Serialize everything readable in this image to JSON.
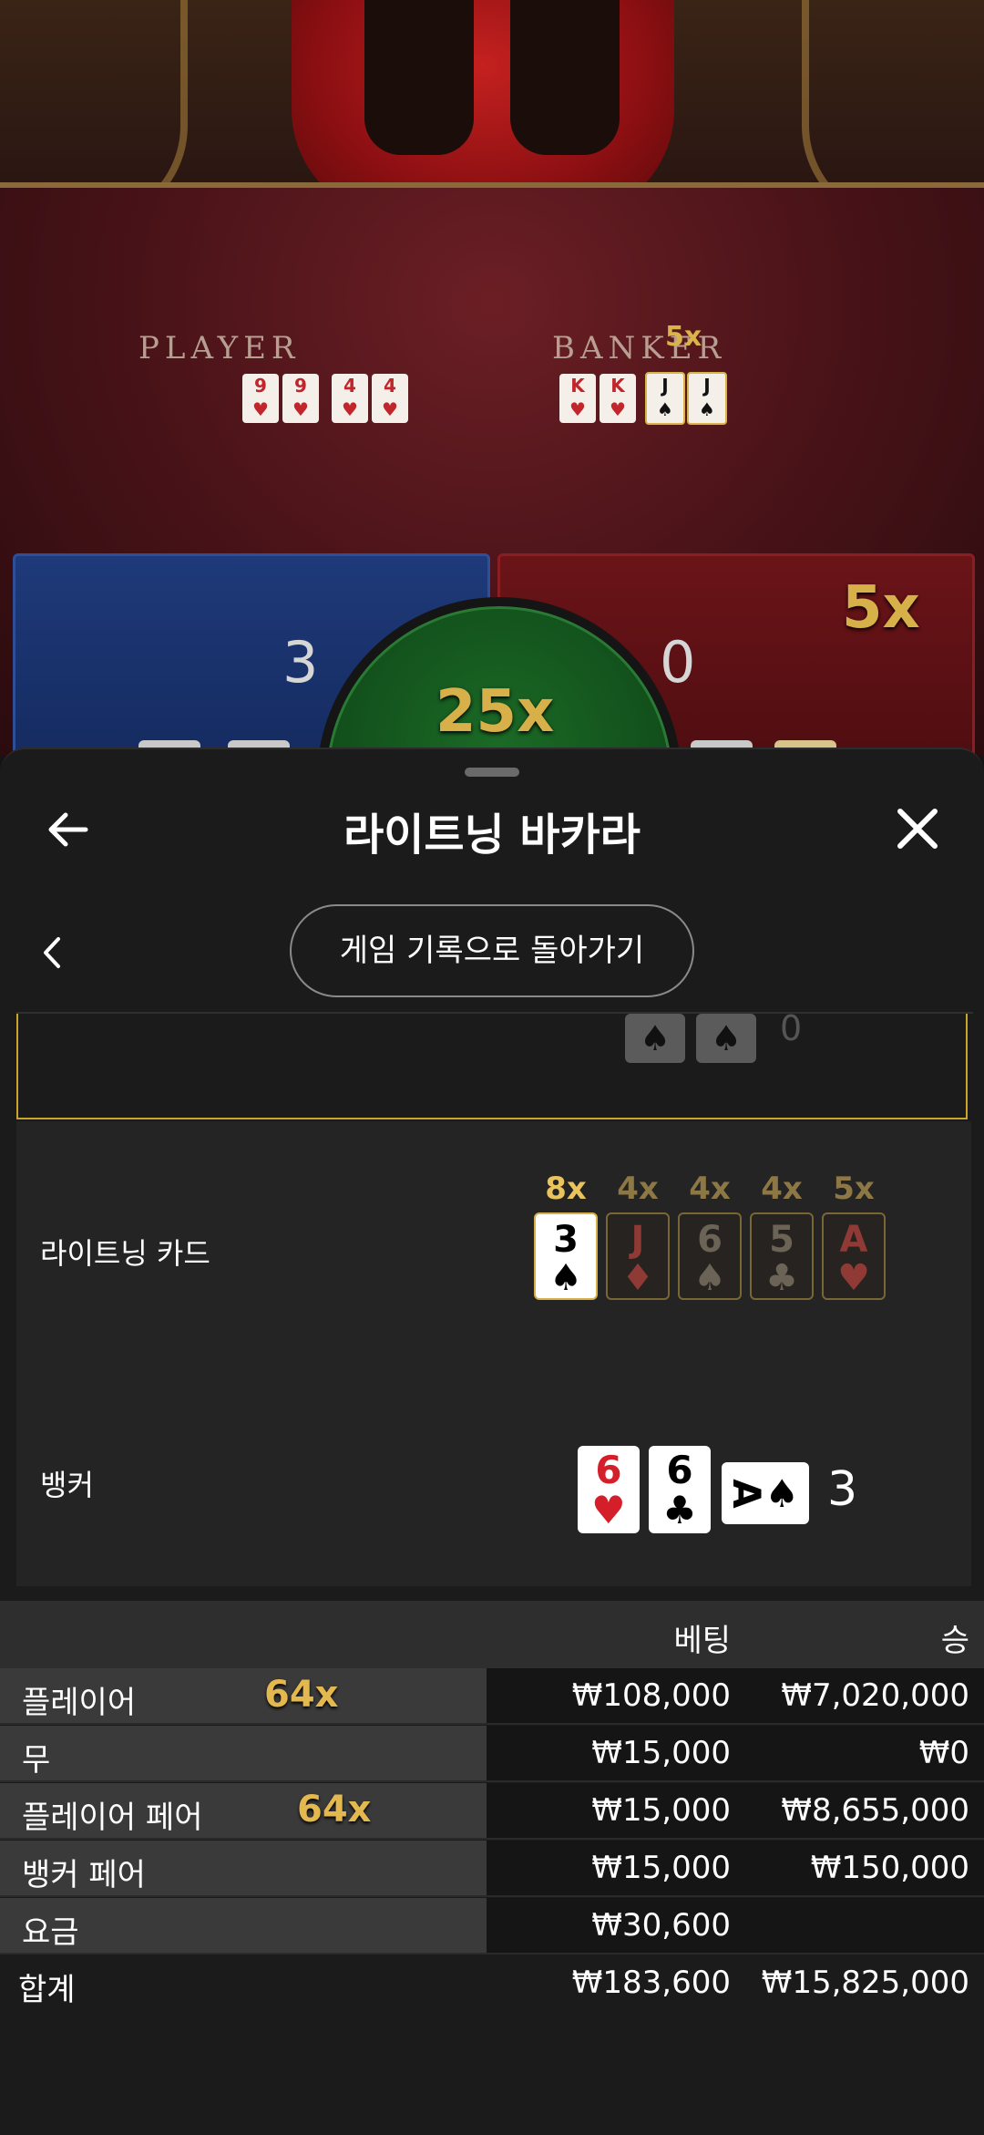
{
  "video": {
    "player_label": "PLAYER",
    "banker_label": "BANKER",
    "banker_multiplier": "5x",
    "player_cards": [
      {
        "rank": "9",
        "suit": "♥"
      },
      {
        "rank": "4",
        "suit": "♥"
      }
    ],
    "banker_cards": [
      {
        "rank": "K",
        "suit": "♥"
      },
      {
        "rank": "J",
        "suit": "♠"
      }
    ]
  },
  "board": {
    "player_score": "3",
    "banker_score": "0",
    "tie_multiplier": "25x",
    "banker_multiplier": "5x"
  },
  "sheet": {
    "title": "라이트닝 바카라",
    "back_to_history": "게임 기록으로 돌아가기",
    "lightning_label": "라이트닝 카드",
    "lightning_cards": [
      {
        "mult": "8x",
        "rank": "3",
        "suit": "♠",
        "lit": true,
        "color": "black"
      },
      {
        "mult": "4x",
        "rank": "J",
        "suit": "♦",
        "lit": false,
        "color": "red"
      },
      {
        "mult": "4x",
        "rank": "6",
        "suit": "♠",
        "lit": false,
        "color": "black"
      },
      {
        "mult": "4x",
        "rank": "5",
        "suit": "♣",
        "lit": false,
        "color": "black"
      },
      {
        "mult": "5x",
        "rank": "A",
        "suit": "♥",
        "lit": false,
        "color": "red"
      }
    ],
    "banker_label": "뱅커",
    "banker_cards": [
      {
        "rank": "6",
        "suit": "♥",
        "color": "red"
      },
      {
        "rank": "6",
        "suit": "♣",
        "color": "black"
      },
      {
        "rank": "A",
        "suit": "♠",
        "color": "black",
        "rotated": true
      }
    ],
    "banker_total": "3",
    "prev_row_total": "0"
  },
  "results": {
    "header": {
      "bet": "베팅",
      "win": "승"
    },
    "rows": [
      {
        "name": "플레이어",
        "mult": "64x",
        "bet": "₩108,000",
        "win": "₩7,020,000"
      },
      {
        "name": "무",
        "mult": "",
        "bet": "₩15,000",
        "win": "₩0"
      },
      {
        "name": "플레이어 페어",
        "mult": "64x",
        "bet": "₩15,000",
        "win": "₩8,655,000"
      },
      {
        "name": "뱅커 페어",
        "mult": "",
        "bet": "₩15,000",
        "win": "₩150,000"
      },
      {
        "name": "요금",
        "mult": "",
        "bet": "₩30,600",
        "win": ""
      }
    ],
    "total": {
      "name": "합계",
      "bet": "₩183,600",
      "win": "₩15,825,000"
    }
  },
  "colors": {
    "gold": "#e3b84e",
    "player_blue": "#1f3a7a",
    "banker_red": "#6b1418",
    "tie_green": "#1b6a26"
  }
}
